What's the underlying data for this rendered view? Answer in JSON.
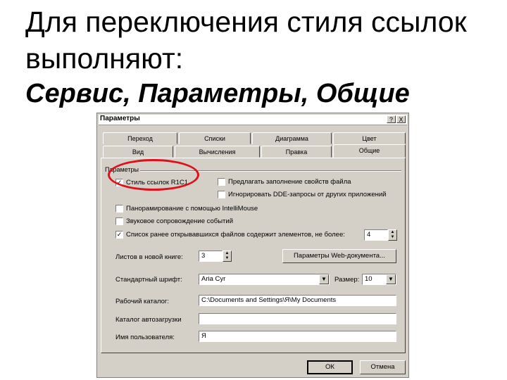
{
  "slide": {
    "line1": "Для переключения стиля ссылок",
    "line2": "выполняют:",
    "line3": "Сервис, Параметры, Общие"
  },
  "dialog": {
    "title": "Параметры",
    "help_btn": "?",
    "close_btn": "X",
    "tabs_row1": [
      "Переход",
      "Списки",
      "Диаграмма",
      "Цвет"
    ],
    "tabs_row2": [
      "Вид",
      "Вычисления",
      "Правка",
      "Общие"
    ],
    "group_label": "Параметры",
    "checkboxes": {
      "r1c1": {
        "label": "Стиль ссылок R1C1",
        "checked": true,
        "mark": "✓"
      },
      "suggest": {
        "label": "Предлагать заполнение свойств файла",
        "checked": false
      },
      "dde": {
        "label": "Игнорировать DDE-запросы от других приложений",
        "checked": false
      },
      "intellimouse": {
        "label": "Панорамирование с помощью IntelliMouse",
        "checked": false
      },
      "sound": {
        "label": "Звуковое сопровождение событий",
        "checked": false
      },
      "recent": {
        "label": "Список ранее открывавшихся файлов содержит элементов, не более:",
        "checked": true,
        "mark": "✓"
      }
    },
    "recent_count": "4",
    "sheets_label": "Листов в новой книге:",
    "sheets_value": "3",
    "web_button": "Параметры Web-документа...",
    "font_label": "Стандартный шрифт:",
    "font_value": "Aria Cyr",
    "size_label": "Размер:",
    "size_value": "10",
    "workdir_label": "Рабочий каталог:",
    "workdir_value": "C:\\Documents and Settings\\Я\\My Documents",
    "autoload_label": "Каталог автозагрузки",
    "autoload_value": "",
    "username_label": "Имя пользователя:",
    "username_value": "Я",
    "ok": "ОК",
    "cancel": "Отмена",
    "arrow_down": "▼",
    "spin_up": "▲",
    "spin_down": "▼"
  },
  "colors": {
    "highlight": "#e0101a",
    "dialog_bg": "#d4d0c8"
  }
}
